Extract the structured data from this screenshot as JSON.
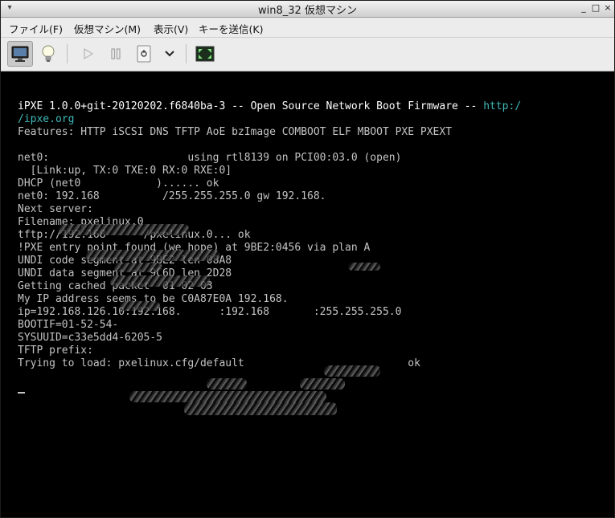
{
  "window": {
    "title": "win8_32 仮想マシン",
    "controls": [
      "_",
      "□",
      "×"
    ]
  },
  "menubar": {
    "items": [
      "ファイル(F)",
      "仮想マシン(M)",
      "表示(V)",
      "キーを送信(K)"
    ]
  },
  "toolbar": {
    "buttons": [
      {
        "icon": "monitor-icon",
        "active": true
      },
      {
        "icon": "lightbulb-icon"
      },
      {
        "icon": "play-icon"
      },
      {
        "icon": "pause-icon"
      },
      {
        "icon": "power-icon"
      },
      {
        "icon": "chevron-down-icon"
      },
      {
        "icon": "fullscreen-icon"
      }
    ]
  },
  "console": {
    "banner_prefix": "iPXE 1.0.0+git-20120202.f6840ba-3",
    "banner_mid": " -- Open Source Network Boot Firmware -- ",
    "banner_link_a": "http:/",
    "banner_link_b": "/ipxe.org",
    "features": "Features: HTTP iSCSI DNS TFTP AoE bzImage COMBOOT ELF MBOOT PXE PXEXT",
    "lines": [
      "net0:                      using rtl8139 on PCI00:03.0 (open)",
      "  [Link:up, TX:0 TXE:0 RX:0 RXE:0]",
      "DHCP (net0            )...... ok",
      "net0: 192.168          /255.255.255.0 gw 192.168.",
      "Next server:",
      "Filename: pxelinux.0",
      "tftp://192.168      /pxelinux.0... ok",
      "!PXE entry point found (we hope) at 9BE2:0456 via plan A",
      "UNDI code segment at 9BE2 len 08A8",
      "UNDI data segment at 9C6D len 2D28",
      "Getting cached packet  01 02 03",
      "My IP address seems to be C0A87E0A 192.168.",
      "ip=192.168.126.10:192.168.      :192.168       :255.255.255.0",
      "BOOTIF=01-52-54-",
      "SYSUUID=c33e5dd4-6205-5",
      "TFTP prefix:",
      "Trying to load: pxelinux.cfg/default                          ok"
    ]
  },
  "colors": {
    "console_text": "#c4c4c4",
    "console_bright": "#ffffff",
    "console_link": "#3fb8b8",
    "screen_bg": "#000000"
  }
}
